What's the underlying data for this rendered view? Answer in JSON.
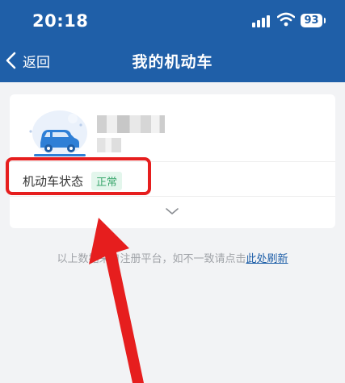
{
  "status_bar": {
    "time": "20:18",
    "battery": "93"
  },
  "nav": {
    "back_label": "返回",
    "title": "我的机动车"
  },
  "vehicle": {
    "status_label": "机动车状态",
    "status_value": "正常"
  },
  "footer": {
    "note": "以上数据来自注册平台，如不一致请点击",
    "refresh_link": "此处刷新"
  },
  "colors": {
    "header": "#1f5fa8",
    "badge_bg": "#e3f6ec",
    "badge_text": "#3aa76d",
    "annotation": "#e61e1e"
  }
}
